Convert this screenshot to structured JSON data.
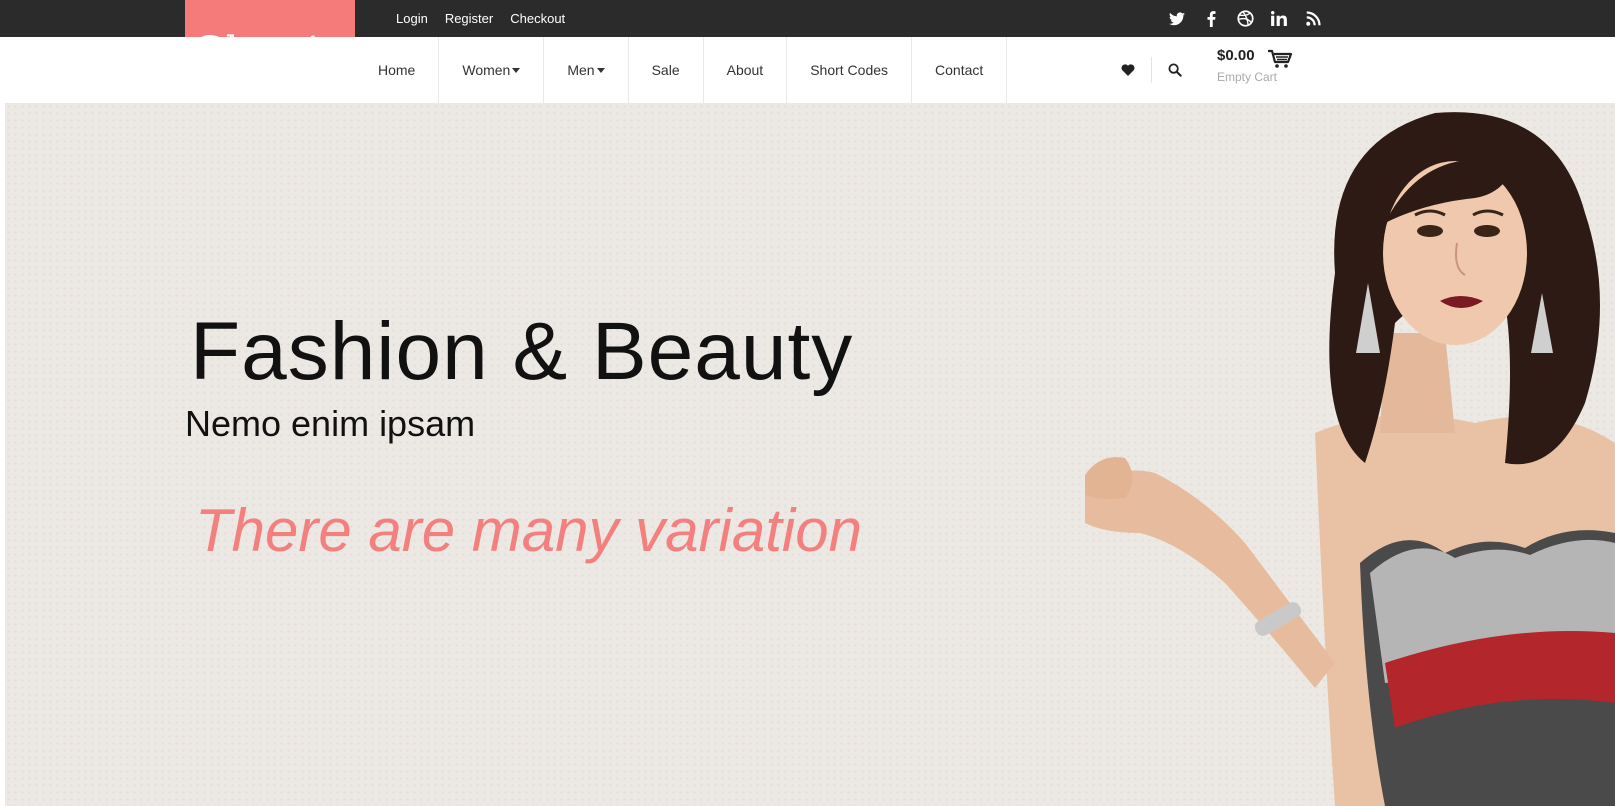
{
  "topbar": {
    "links": [
      "Login",
      "Register",
      "Checkout"
    ],
    "social": [
      "twitter-icon",
      "facebook-icon",
      "dribbble-icon",
      "linkedin-icon",
      "rss-icon"
    ]
  },
  "logo": {
    "text": "Shopin"
  },
  "nav": {
    "items": [
      {
        "label": "Home",
        "dropdown": false
      },
      {
        "label": "Women",
        "dropdown": true
      },
      {
        "label": "Men",
        "dropdown": true
      },
      {
        "label": "Sale",
        "dropdown": false
      },
      {
        "label": "About",
        "dropdown": false
      },
      {
        "label": "Short Codes",
        "dropdown": false
      },
      {
        "label": "Contact",
        "dropdown": false
      }
    ]
  },
  "tools": {
    "icons": [
      "heart-icon",
      "search-icon"
    ]
  },
  "cart": {
    "price": "$0.00",
    "status": "Empty Cart"
  },
  "hero": {
    "title": "Fashion & Beauty",
    "subtitle": "Nemo enim ipsam",
    "tagline": "There are many variation"
  },
  "colors": {
    "accent": "#f57b7b",
    "topbar": "#2b2b2b",
    "hero_bg": "#ece8e4",
    "tagline": "#f47f7f"
  }
}
